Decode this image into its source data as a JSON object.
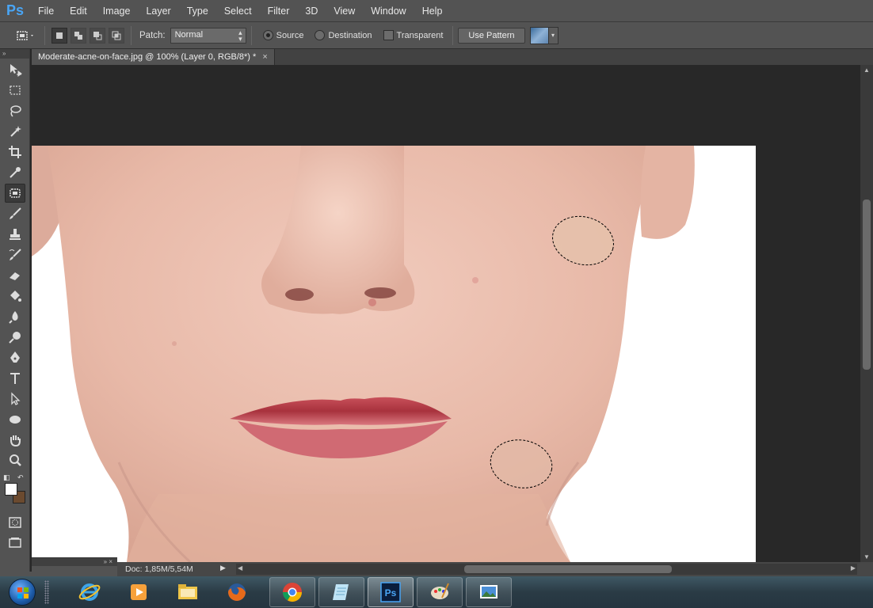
{
  "app": {
    "logo": "Ps",
    "menu": [
      "File",
      "Edit",
      "Image",
      "Layer",
      "Type",
      "Select",
      "Filter",
      "3D",
      "View",
      "Window",
      "Help"
    ]
  },
  "options_bar": {
    "tool_preset_icon": "patch-tool-icon",
    "selection_modes": [
      "new-selection",
      "add-to-selection",
      "subtract-from-selection",
      "intersect-with-selection"
    ],
    "patch_label": "Patch:",
    "patch_mode": "Normal",
    "source_label": "Source",
    "destination_label": "Destination",
    "transparent_label": "Transparent",
    "use_pattern_label": "Use Pattern",
    "source_checked": true,
    "destination_checked": false,
    "transparent_checked": false
  },
  "document": {
    "tab_title": "Moderate-acne-on-face.jpg @ 100% (Layer 0, RGB/8*) *",
    "close_glyph": "×"
  },
  "tools": [
    {
      "name": "move-tool-icon"
    },
    {
      "name": "marquee-tool-icon"
    },
    {
      "name": "lasso-tool-icon"
    },
    {
      "name": "magic-wand-tool-icon"
    },
    {
      "name": "crop-tool-icon"
    },
    {
      "name": "eyedropper-tool-icon"
    },
    {
      "name": "patch-tool-icon",
      "active": true
    },
    {
      "name": "brush-tool-icon"
    },
    {
      "name": "clone-stamp-tool-icon"
    },
    {
      "name": "history-brush-tool-icon"
    },
    {
      "name": "eraser-tool-icon"
    },
    {
      "name": "paint-bucket-tool-icon"
    },
    {
      "name": "blur-tool-icon"
    },
    {
      "name": "dodge-tool-icon"
    },
    {
      "name": "pen-tool-icon"
    },
    {
      "name": "type-tool-icon"
    },
    {
      "name": "path-selection-tool-icon"
    },
    {
      "name": "ellipse-tool-icon"
    },
    {
      "name": "hand-tool-icon"
    },
    {
      "name": "zoom-tool-icon"
    }
  ],
  "colors": {
    "foreground": "#ffffff",
    "background": "#6b4a2f",
    "accent": "#49a5f5"
  },
  "status": {
    "doc_size": "Doc: 1,85M/5,54M"
  },
  "taskbar": {
    "items": [
      "start-orb",
      "internet-explorer-icon",
      "media-player-icon",
      "windows-explorer-icon",
      "firefox-icon",
      "chrome-icon",
      "notepad-icon",
      "photoshop-icon",
      "paint-icon",
      "photo-viewer-icon"
    ],
    "active": "photoshop-icon"
  }
}
